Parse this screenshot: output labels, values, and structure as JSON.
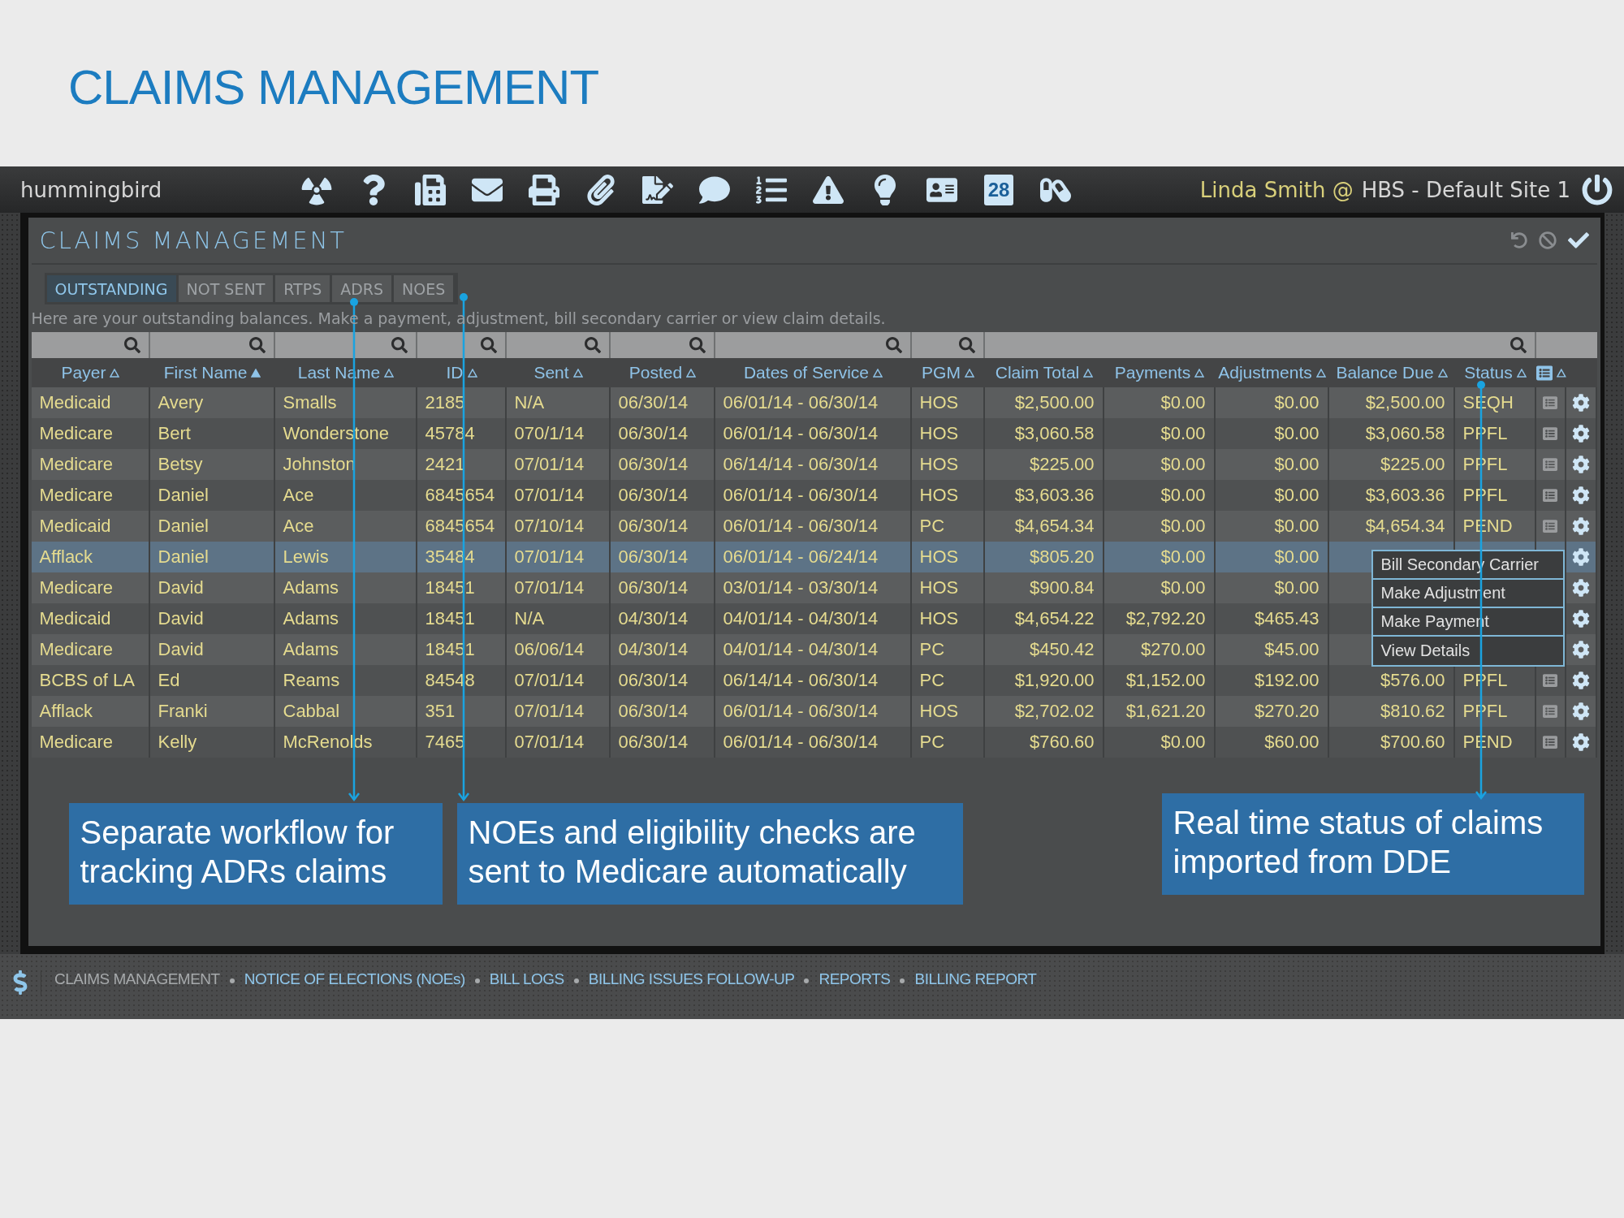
{
  "slide_title": "CLAIMS MANAGEMENT",
  "app_bar": {
    "brand": "hummingbird",
    "tools": [
      {
        "kind": "radiation"
      },
      {
        "kind": "help"
      },
      {
        "kind": "phone"
      },
      {
        "kind": "mail"
      },
      {
        "kind": "print"
      },
      {
        "kind": "clip"
      },
      {
        "kind": "sign"
      },
      {
        "kind": "chat"
      },
      {
        "kind": "list"
      },
      {
        "kind": "warning"
      },
      {
        "kind": "bulb"
      },
      {
        "kind": "contact"
      },
      {
        "kind": "calendar",
        "text": "28"
      },
      {
        "kind": "pill"
      }
    ],
    "user": "Linda Smith @",
    "site": "HBS - Default Site 1"
  },
  "panel": {
    "title": "CLAIMS MANAGEMENT",
    "tabs": [
      {
        "label": "OUTSTANDING",
        "selected": true
      },
      {
        "label": "NOT SENT",
        "selected": false
      },
      {
        "label": "RTPS",
        "selected": false
      },
      {
        "label": "ADRS",
        "selected": false
      },
      {
        "label": "NOES",
        "selected": false
      }
    ],
    "hint": "Here are your outstanding balances. Make a payment, adjustment, bill secondary carrier or view claim details.",
    "table": {
      "columns": [
        {
          "kind": "text",
          "label": "Payer",
          "sorted": false,
          "filter": true
        },
        {
          "kind": "text",
          "label": "First Name",
          "sorted": true,
          "filter": true
        },
        {
          "kind": "text",
          "label": "Last Name",
          "sorted": false,
          "filter": true
        },
        {
          "kind": "text",
          "label": "ID",
          "sorted": false,
          "filter": true
        },
        {
          "kind": "text",
          "label": "Sent",
          "sorted": false,
          "filter": true
        },
        {
          "kind": "text",
          "label": "Posted",
          "sorted": false,
          "filter": true
        },
        {
          "kind": "text",
          "label": "Dates of Service",
          "sorted": false,
          "filter": true
        },
        {
          "kind": "text",
          "label": "PGM",
          "sorted": false,
          "filter": true
        },
        {
          "kind": "money",
          "label": "Claim Total",
          "sorted": false,
          "filter": false
        },
        {
          "kind": "money",
          "label": "Payments",
          "sorted": false,
          "filter": false
        },
        {
          "kind": "money",
          "label": "Adjustments",
          "sorted": false,
          "filter": false
        },
        {
          "kind": "money",
          "label": "Balance Due",
          "sorted": false,
          "filter": false
        },
        {
          "kind": "text",
          "label": "Status",
          "sorted": false,
          "filter": true
        },
        {
          "kind": "icon",
          "sorted": false
        },
        {
          "kind": "action"
        }
      ],
      "rows": [
        {
          "selected": false,
          "note": true,
          "cells": [
            "Medicaid",
            "Avery",
            "Smalls",
            "2185",
            "N/A",
            "06/30/14",
            "06/01/14 - 06/30/14",
            "HOS",
            "$2,500.00",
            "$0.00",
            "$0.00",
            "$2,500.00",
            "SEQH"
          ]
        },
        {
          "selected": false,
          "note": true,
          "cells": [
            "Medicare",
            "Bert",
            "Wonderstone",
            "45784",
            "070/1/14",
            "06/30/14",
            "06/01/14 - 06/30/14",
            "HOS",
            "$3,060.58",
            "$0.00",
            "$0.00",
            "$3,060.58",
            "PPFL"
          ]
        },
        {
          "selected": false,
          "note": true,
          "cells": [
            "Medicare",
            "Betsy",
            "Johnston",
            "2421",
            "07/01/14",
            "06/30/14",
            "06/14/14 - 06/30/14",
            "HOS",
            "$225.00",
            "$0.00",
            "$0.00",
            "$225.00",
            "PPFL"
          ]
        },
        {
          "selected": false,
          "note": true,
          "cells": [
            "Medicare",
            "Daniel",
            "Ace",
            "6845654",
            "07/01/14",
            "06/30/14",
            "06/01/14 - 06/30/14",
            "HOS",
            "$3,603.36",
            "$0.00",
            "$0.00",
            "$3,603.36",
            "PPFL"
          ]
        },
        {
          "selected": false,
          "note": true,
          "cells": [
            "Medicaid",
            "Daniel",
            "Ace",
            "6845654",
            "07/10/14",
            "06/30/14",
            "06/01/14 - 06/30/14",
            "PC",
            "$4,654.34",
            "$0.00",
            "$0.00",
            "$4,654.34",
            "PEND"
          ]
        },
        {
          "selected": true,
          "note": false,
          "cells": [
            "Afflack",
            "Daniel",
            "Lewis",
            "35484",
            "07/01/14",
            "06/30/14",
            "06/01/14 - 06/24/14",
            "HOS",
            "$805.20",
            "$0.00",
            "$0.00"
          ]
        },
        {
          "selected": false,
          "cells": [
            "Medicare",
            "David",
            "Adams",
            "18451",
            "07/01/14",
            "06/30/14",
            "03/01/14 - 03/30/14",
            "HOS",
            "$900.84",
            "$0.00",
            "$0.00"
          ]
        },
        {
          "selected": false,
          "cells": [
            "Medicaid",
            "David",
            "Adams",
            "18451",
            "N/A",
            "04/30/14",
            "04/01/14 - 04/30/14",
            "HOS",
            "$4,654.22",
            "$2,792.20",
            "$465.43"
          ]
        },
        {
          "selected": false,
          "cells": [
            "Medicare",
            "David",
            "Adams",
            "18451",
            "06/06/14",
            "04/30/14",
            "04/01/14 - 04/30/14",
            "PC",
            "$450.42",
            "$270.00",
            "$45.00"
          ]
        },
        {
          "selected": false,
          "note": true,
          "cells": [
            "BCBS of LA",
            "Ed",
            "Reams",
            "84548",
            "07/01/14",
            "06/30/14",
            "06/14/14 - 06/30/14",
            "PC",
            "$1,920.00",
            "$1,152.00",
            "$192.00",
            "$576.00",
            "PPFL"
          ]
        },
        {
          "selected": false,
          "note": true,
          "cells": [
            "Afflack",
            "Franki",
            "Cabbal",
            "351",
            "07/01/14",
            "06/30/14",
            "06/01/14 - 06/30/14",
            "HOS",
            "$2,702.02",
            "$1,621.20",
            "$270.20",
            "$810.62",
            "PPFL"
          ]
        },
        {
          "selected": false,
          "note": true,
          "cells": [
            "Medicare",
            "Kelly",
            "McRenolds",
            "7465",
            "07/01/14",
            "06/30/14",
            "06/01/14 - 06/30/14",
            "PC",
            "$760.60",
            "$0.00",
            "$60.00",
            "$700.60",
            "PEND"
          ]
        }
      ],
      "menu": [
        "Bill Secondary Carrier",
        "Make Adjustment",
        "Make Payment",
        "View Details"
      ]
    },
    "callouts": [
      "Separate workflow for tracking ADRs claims",
      "NOEs and eligibility checks are sent to Medicare automatically",
      "Real time status of claims imported from DDE"
    ]
  },
  "footer": {
    "crumbs": [
      {
        "label": "CLAIMS MANAGEMENT",
        "current": true
      },
      {
        "label": "NOTICE OF ELECTIONS (NOEs)",
        "current": false
      },
      {
        "label": "BILL LOGS",
        "current": false
      },
      {
        "label": "BILLING ISSUES FOLLOW-UP",
        "current": false
      },
      {
        "label": "REPORTS",
        "current": false
      },
      {
        "label": "BILLING REPORT",
        "current": false
      }
    ]
  }
}
